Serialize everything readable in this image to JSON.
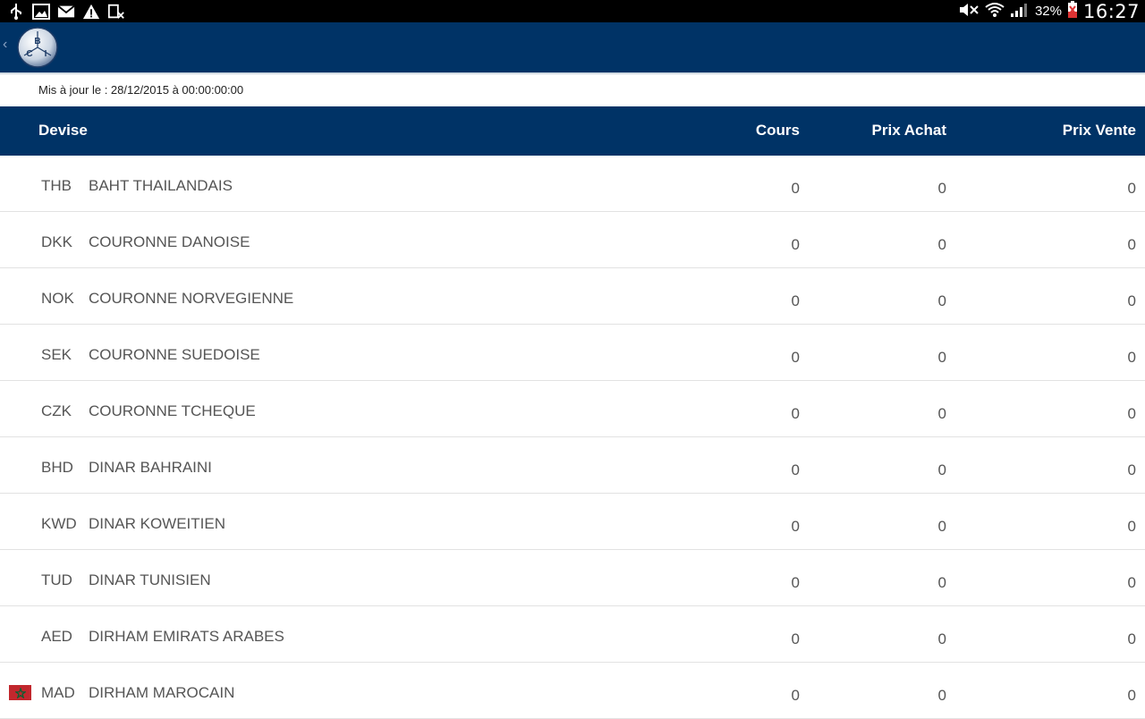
{
  "status_bar": {
    "left_icons": [
      "usb-icon",
      "image-icon",
      "mail-icon",
      "warning-icon",
      "sim-error-icon"
    ],
    "right_icons": [
      "mute-icon",
      "wifi-icon",
      "signal-icon",
      "battery-icon"
    ],
    "battery_percent": "32%",
    "time": "16:27"
  },
  "app_bar": {
    "logo_letters": [
      "B",
      "C",
      "I"
    ],
    "back_glyph": "‹"
  },
  "updated_text": "Mis à jour le : 28/12/2015 à 00:00:00:00",
  "table": {
    "headers": {
      "devise": "Devise",
      "cours": "Cours",
      "achat": "Prix Achat",
      "vente": "Prix Vente"
    },
    "rows": [
      {
        "code": "THB",
        "name": "BAHT THAILANDAIS",
        "cours": "0",
        "achat": "0",
        "vente": "0"
      },
      {
        "code": "DKK",
        "name": "COURONNE DANOISE",
        "cours": "0",
        "achat": "0",
        "vente": "0"
      },
      {
        "code": "NOK",
        "name": "COURONNE NORVEGIENNE",
        "cours": "0",
        "achat": "0",
        "vente": "0"
      },
      {
        "code": "SEK",
        "name": "COURONNE SUEDOISE",
        "cours": "0",
        "achat": "0",
        "vente": "0"
      },
      {
        "code": "CZK",
        "name": "COURONNE TCHEQUE",
        "cours": "0",
        "achat": "0",
        "vente": "0"
      },
      {
        "code": "BHD",
        "name": "DINAR BAHRAINI",
        "cours": "0",
        "achat": "0",
        "vente": "0"
      },
      {
        "code": "KWD",
        "name": "DINAR KOWEITIEN",
        "cours": "0",
        "achat": "0",
        "vente": "0"
      },
      {
        "code": "TUD",
        "name": "DINAR TUNISIEN",
        "cours": "0",
        "achat": "0",
        "vente": "0"
      },
      {
        "code": "AED",
        "name": "DIRHAM EMIRATS ARABES",
        "cours": "0",
        "achat": "0",
        "vente": "0"
      },
      {
        "code": "MAD",
        "name": "DIRHAM MAROCAIN",
        "cours": "0",
        "achat": "0",
        "vente": "0",
        "flag": "morocco-flag-icon"
      }
    ]
  },
  "colors": {
    "primary": "#003366",
    "row_text": "#555555",
    "divider": "#e2e2e2"
  }
}
